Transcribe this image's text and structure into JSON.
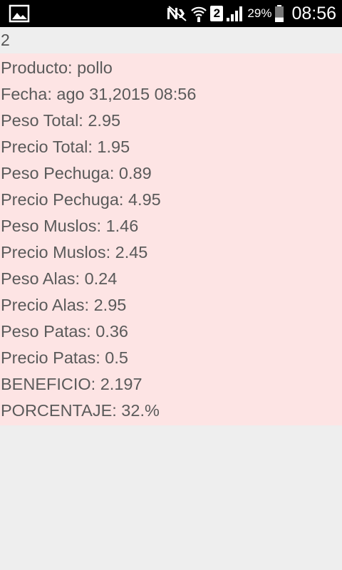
{
  "status_bar": {
    "left_icon": "image-notification-icon",
    "icons": [
      "nfc-muted-icon",
      "wifi-icon",
      "sim-2-icon",
      "signal-icon"
    ],
    "sim_label": "2",
    "battery_percent": "29%",
    "battery_level": 0.29,
    "time": "08:56"
  },
  "record": {
    "id": "2",
    "lines": [
      "Producto: pollo",
      "Fecha: ago 31,2015 08:56",
      "Peso Total: 2.95",
      "Precio Total: 1.95",
      "Peso Pechuga: 0.89",
      "Precio Pechuga: 4.95",
      "Peso Muslos: 1.46",
      "Precio Muslos: 2.45",
      "Peso Alas: 0.24",
      "Precio Alas: 2.95",
      "Peso Patas: 0.36",
      "Precio Patas: 0.5",
      "BENEFICIO: 2.197",
      "PORCENTAJE: 32.%"
    ]
  },
  "colors": {
    "background": "#eeeeee",
    "highlight": "#fde4e4",
    "text": "#5a5a5a",
    "status_bar": "#000000"
  }
}
